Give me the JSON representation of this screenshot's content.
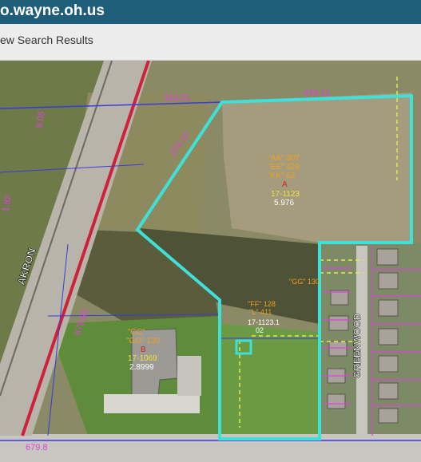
{
  "header": {
    "title": "o.wayne.oh.us"
  },
  "subbar": {
    "link_label": "ew Search Results"
  },
  "map": {
    "road_label": "AKRON",
    "street_label": "GREENWOOD",
    "parcels": {
      "main": {
        "codes": [
          "\"AA\" 307",
          "\"EE\" 429",
          "\"KK\" 62"
        ],
        "letter": "A",
        "id": "17-1123",
        "acres": "5.976"
      },
      "left": {
        "codes": [
          "\"CC\"",
          "\"GG\" 130"
        ],
        "letter": "B",
        "id": "17-1069",
        "acres": "2.8999"
      },
      "center": {
        "codes": [
          "\"FF\" 128",
          "\"L\" 411"
        ],
        "id": "17-1123.1",
        "acres": "02"
      },
      "east_small": {
        "codes": [
          "\"GG\" 130"
        ]
      }
    },
    "dimensions": {
      "top_left": "162.01",
      "top_right": "476.11",
      "nw_diag": "274.12",
      "far_left_top": "9.05",
      "far_left_mid": "1.82",
      "left_road": "679.93",
      "bottom": "679.8"
    },
    "colors": {
      "parcel_outline": "#3fe0d8",
      "road_line": "#d0203a",
      "lot_line_magenta": "#e040e0",
      "lot_line_yellow": "#e8e84a",
      "label_orange": "#f0a020",
      "label_white": "#ffffff",
      "township_line": "#3a3adc"
    }
  }
}
